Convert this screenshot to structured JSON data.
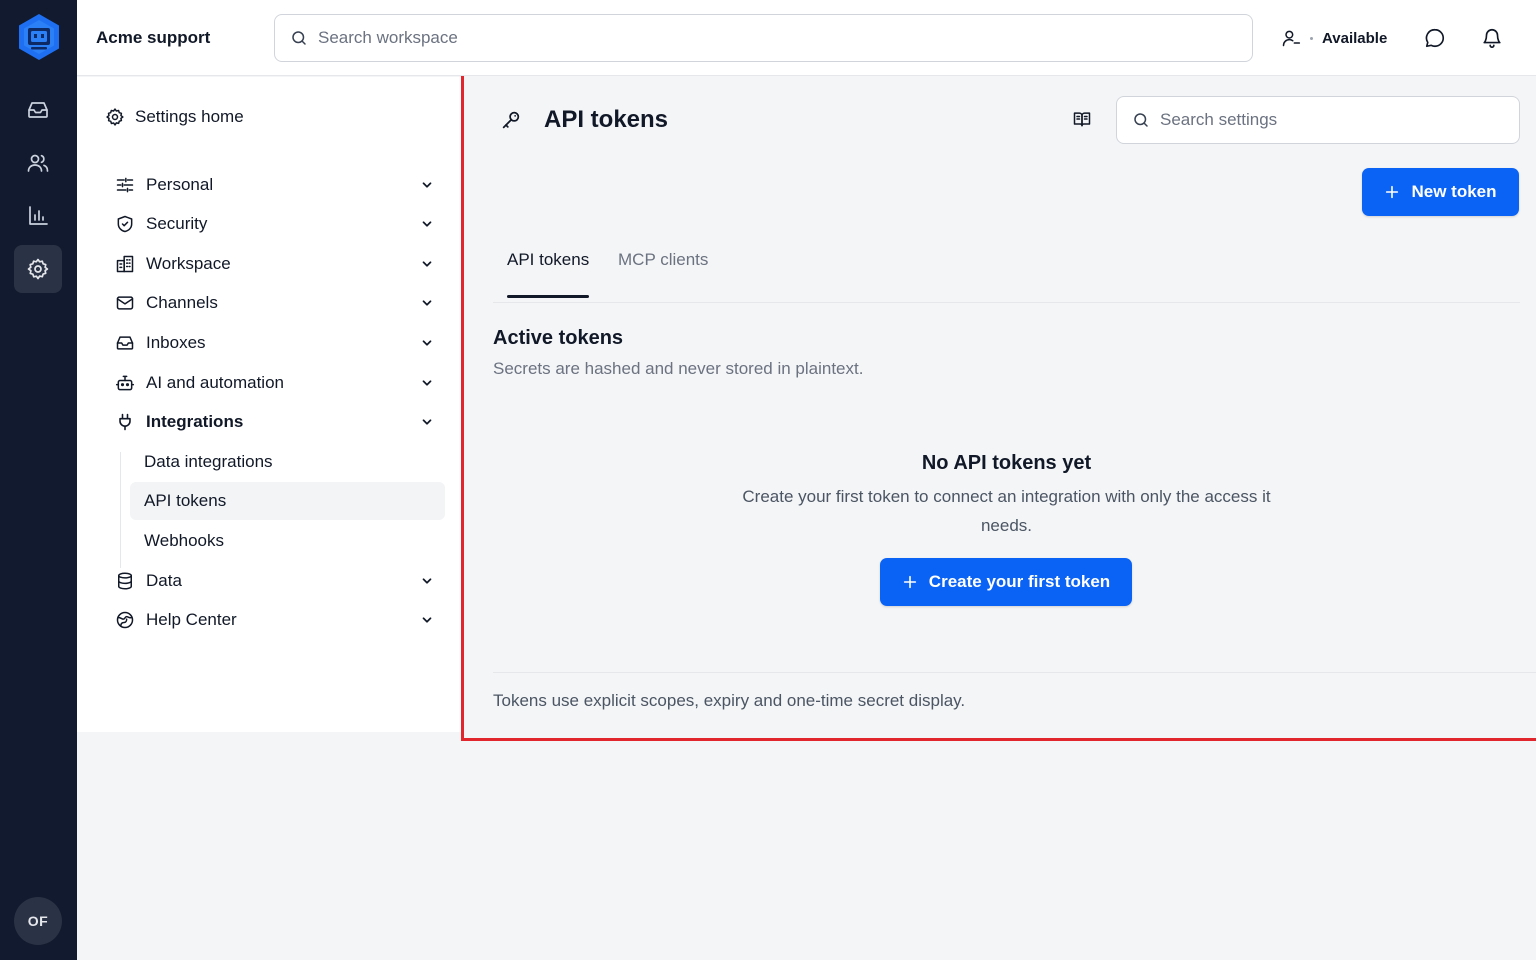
{
  "workspace": {
    "name": "Acme support"
  },
  "topbar": {
    "search_placeholder": "Search workspace",
    "status_label": "Available"
  },
  "user": {
    "initials": "OF"
  },
  "rail": {
    "items": [
      {
        "icon": "inbox-icon"
      },
      {
        "icon": "users-icon"
      },
      {
        "icon": "bar-chart-icon"
      },
      {
        "icon": "gear-icon",
        "active": true
      }
    ]
  },
  "settings_nav": {
    "home_label": "Settings home",
    "items": [
      {
        "label": "Personal",
        "icon": "sliders-icon"
      },
      {
        "label": "Security",
        "icon": "shield-icon"
      },
      {
        "label": "Workspace",
        "icon": "building-icon"
      },
      {
        "label": "Channels",
        "icon": "mail-icon"
      },
      {
        "label": "Inboxes",
        "icon": "inbox-icon"
      },
      {
        "label": "AI and automation",
        "icon": "bot-icon"
      },
      {
        "label": "Integrations",
        "icon": "plug-icon",
        "expanded": true
      },
      {
        "label": "Data",
        "icon": "database-icon"
      },
      {
        "label": "Help Center",
        "icon": "globe-icon"
      }
    ],
    "sub_items": [
      {
        "label": "Data integrations"
      },
      {
        "label": "API tokens",
        "active": true
      },
      {
        "label": "Webhooks"
      }
    ]
  },
  "main": {
    "title": "API tokens",
    "search_placeholder": "Search settings",
    "new_token_label": "New token",
    "tabs": [
      {
        "label": "API tokens",
        "active": true
      },
      {
        "label": "MCP clients",
        "active": false
      }
    ],
    "section_title": "Active tokens",
    "section_subtitle": "Secrets are hashed and never stored in plaintext.",
    "empty_title": "No API tokens yet",
    "empty_description": "Create your first token to connect an integration with only the access it needs.",
    "create_first_label": "Create your first token",
    "footer_note": "Tokens use explicit scopes, expiry and one-time secret display."
  },
  "colors": {
    "rail_bg": "#111a2e",
    "primary": "#0b63f6",
    "highlight_border": "#e1262d"
  }
}
